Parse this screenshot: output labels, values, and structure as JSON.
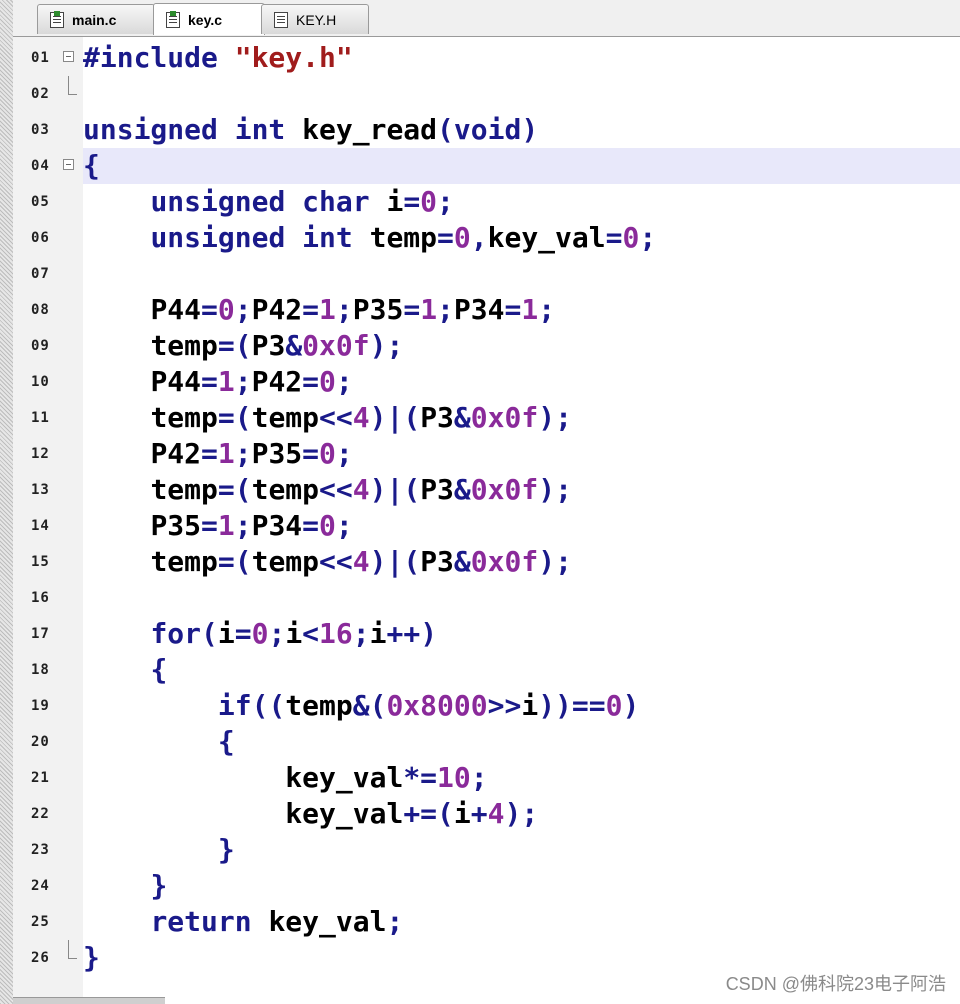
{
  "tabs": [
    {
      "label": "main.c",
      "icon": "source-file-icon"
    },
    {
      "label": "key.c",
      "icon": "source-file-icon"
    },
    {
      "label": "KEY.H",
      "icon": "header-file-icon"
    }
  ],
  "code_lines": [
    {
      "num": "01",
      "text": "#include \"key.h\""
    },
    {
      "num": "02",
      "text": ""
    },
    {
      "num": "03",
      "text": "unsigned int key_read(void)"
    },
    {
      "num": "04",
      "text": "{"
    },
    {
      "num": "05",
      "text": "    unsigned char i=0;"
    },
    {
      "num": "06",
      "text": "    unsigned int temp=0,key_val=0;"
    },
    {
      "num": "07",
      "text": ""
    },
    {
      "num": "08",
      "text": "    P44=0;P42=1;P35=1;P34=1;"
    },
    {
      "num": "09",
      "text": "    temp=(P3&0x0f);"
    },
    {
      "num": "10",
      "text": "    P44=1;P42=0;"
    },
    {
      "num": "11",
      "text": "    temp=(temp<<4)|(P3&0x0f);"
    },
    {
      "num": "12",
      "text": "    P42=1;P35=0;"
    },
    {
      "num": "13",
      "text": "    temp=(temp<<4)|(P3&0x0f);"
    },
    {
      "num": "14",
      "text": "    P35=1;P34=0;"
    },
    {
      "num": "15",
      "text": "    temp=(temp<<4)|(P3&0x0f);"
    },
    {
      "num": "16",
      "text": ""
    },
    {
      "num": "17",
      "text": "    for(i=0;i<16;i++)"
    },
    {
      "num": "18",
      "text": "    {"
    },
    {
      "num": "19",
      "text": "        if((temp&(0x8000>>i))==0)"
    },
    {
      "num": "20",
      "text": "        {"
    },
    {
      "num": "21",
      "text": "            key_val*=10;"
    },
    {
      "num": "22",
      "text": "            key_val+=(i+4);"
    },
    {
      "num": "23",
      "text": "        }"
    },
    {
      "num": "24",
      "text": "    }"
    },
    {
      "num": "25",
      "text": "    return key_val;"
    },
    {
      "num": "26",
      "text": "}"
    }
  ],
  "highlighted_line": "04",
  "watermark": "CSDN @佛科院23电子阿浩",
  "colors": {
    "keyword": "#1a1a8a",
    "number": "#8a2a9a",
    "string": "#a01c1c",
    "current_line": "#e8e8fa"
  }
}
